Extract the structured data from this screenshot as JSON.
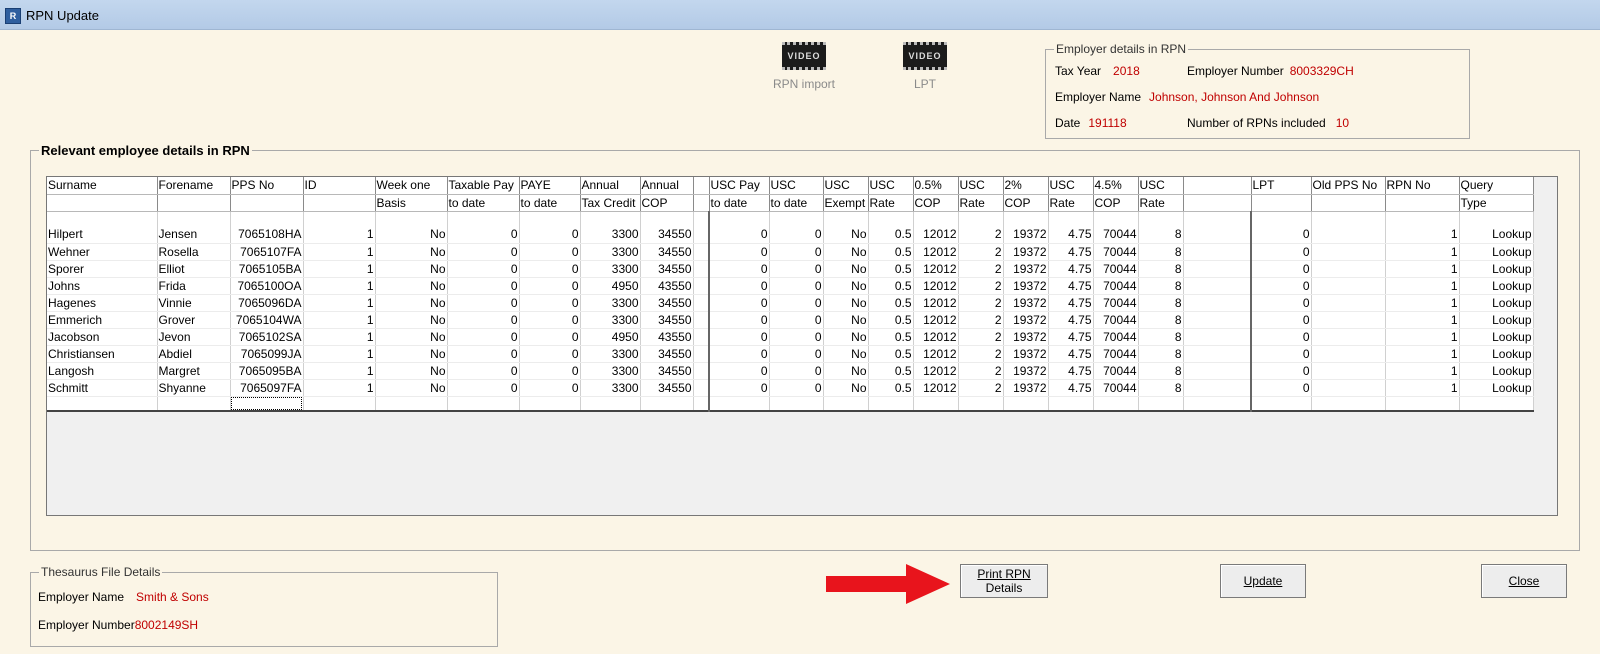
{
  "window": {
    "title": "RPN Update"
  },
  "videos": [
    {
      "label": "RPN import",
      "badge": "VIDEO"
    },
    {
      "label": "LPT",
      "badge": "VIDEO"
    }
  ],
  "employer_rpn": {
    "legend": "Employer details in RPN",
    "tax_year_label": "Tax Year",
    "tax_year": "2018",
    "employer_number_label": "Employer Number",
    "employer_number": "8003329CH",
    "employer_name_label": "Employer Name",
    "employer_name": "Johnson, Johnson And Johnson",
    "date_label": "Date",
    "date": "191118",
    "num_rpns_label": "Number of RPNs included",
    "num_rpns": "10"
  },
  "employee_section": {
    "legend": "Relevant employee details in RPN"
  },
  "table": {
    "header1": [
      "Surname",
      "Forename",
      "PPS No",
      "ID",
      "Week one",
      "Taxable Pay",
      "PAYE",
      "Annual",
      "Annual",
      "",
      "USC Pay",
      "USC",
      "USC",
      "USC",
      "0.5%",
      "USC",
      "2%",
      "USC",
      "4.5%",
      "USC",
      "",
      "LPT",
      "Old PPS No",
      "RPN No",
      "Query"
    ],
    "header2": [
      "",
      "",
      "",
      "",
      "Basis",
      "to date",
      "to date",
      "Tax Credit",
      "COP",
      "",
      "to date",
      "to date",
      "Exempt",
      "Rate",
      "COP",
      "Rate",
      "COP",
      "Rate",
      "COP",
      "Rate",
      "",
      "",
      "",
      "",
      "Type"
    ],
    "rows": [
      [
        "Hilpert",
        "Jensen",
        "7065108HA",
        "1",
        "No",
        "0",
        "0",
        "3300",
        "34550",
        "",
        "0",
        "0",
        "No",
        "0.5",
        "12012",
        "2",
        "19372",
        "4.75",
        "70044",
        "8",
        "",
        "0",
        "",
        "1",
        "Lookup"
      ],
      [
        "Wehner",
        "Rosella",
        "7065107FA",
        "1",
        "No",
        "0",
        "0",
        "3300",
        "34550",
        "",
        "0",
        "0",
        "No",
        "0.5",
        "12012",
        "2",
        "19372",
        "4.75",
        "70044",
        "8",
        "",
        "0",
        "",
        "1",
        "Lookup"
      ],
      [
        "Sporer",
        "Elliot",
        "7065105BA",
        "1",
        "No",
        "0",
        "0",
        "3300",
        "34550",
        "",
        "0",
        "0",
        "No",
        "0.5",
        "12012",
        "2",
        "19372",
        "4.75",
        "70044",
        "8",
        "",
        "0",
        "",
        "1",
        "Lookup"
      ],
      [
        "Johns",
        "Frida",
        "7065100OA",
        "1",
        "No",
        "0",
        "0",
        "4950",
        "43550",
        "",
        "0",
        "0",
        "No",
        "0.5",
        "12012",
        "2",
        "19372",
        "4.75",
        "70044",
        "8",
        "",
        "0",
        "",
        "1",
        "Lookup"
      ],
      [
        "Hagenes",
        "Vinnie",
        "7065096DA",
        "1",
        "No",
        "0",
        "0",
        "3300",
        "34550",
        "",
        "0",
        "0",
        "No",
        "0.5",
        "12012",
        "2",
        "19372",
        "4.75",
        "70044",
        "8",
        "",
        "0",
        "",
        "1",
        "Lookup"
      ],
      [
        "Emmerich",
        "Grover",
        "7065104WA",
        "1",
        "No",
        "0",
        "0",
        "3300",
        "34550",
        "",
        "0",
        "0",
        "No",
        "0.5",
        "12012",
        "2",
        "19372",
        "4.75",
        "70044",
        "8",
        "",
        "0",
        "",
        "1",
        "Lookup"
      ],
      [
        "Jacobson",
        "Jevon",
        "7065102SA",
        "1",
        "No",
        "0",
        "0",
        "4950",
        "43550",
        "",
        "0",
        "0",
        "No",
        "0.5",
        "12012",
        "2",
        "19372",
        "4.75",
        "70044",
        "8",
        "",
        "0",
        "",
        "1",
        "Lookup"
      ],
      [
        "Christiansen",
        "Abdiel",
        "7065099JA",
        "1",
        "No",
        "0",
        "0",
        "3300",
        "34550",
        "",
        "0",
        "0",
        "No",
        "0.5",
        "12012",
        "2",
        "19372",
        "4.75",
        "70044",
        "8",
        "",
        "0",
        "",
        "1",
        "Lookup"
      ],
      [
        "Langosh",
        "Margret",
        "7065095BA",
        "1",
        "No",
        "0",
        "0",
        "3300",
        "34550",
        "",
        "0",
        "0",
        "No",
        "0.5",
        "12012",
        "2",
        "19372",
        "4.75",
        "70044",
        "8",
        "",
        "0",
        "",
        "1",
        "Lookup"
      ],
      [
        "Schmitt",
        "Shyanne",
        "7065097FA",
        "1",
        "No",
        "0",
        "0",
        "3300",
        "34550",
        "",
        "0",
        "0",
        "No",
        "0.5",
        "12012",
        "2",
        "19372",
        "4.75",
        "70044",
        "8",
        "",
        "0",
        "",
        "1",
        "Lookup"
      ]
    ]
  },
  "thesaurus": {
    "legend": "Thesaurus File Details",
    "employer_name_label": "Employer Name",
    "employer_name": "Smith & Sons",
    "employer_number_label": "Employer Number",
    "employer_number": "8002149SH"
  },
  "buttons": {
    "print_line1": "Print RPN",
    "print_line2": "Details",
    "update": "Update",
    "close": "Close"
  },
  "colors": {
    "value_red": "#c00000",
    "arrow_red": "#e8141c",
    "background": "#fbf5e6"
  }
}
